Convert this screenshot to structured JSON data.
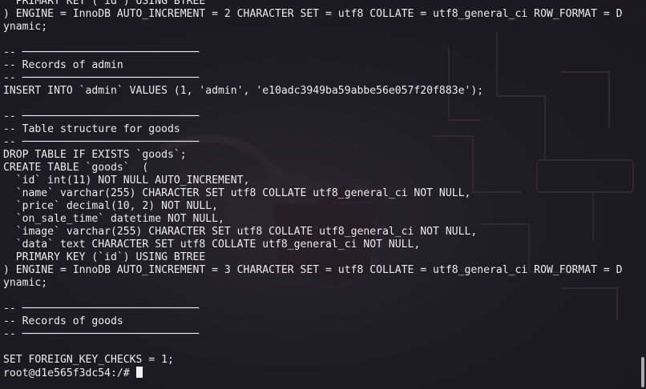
{
  "terminal": {
    "lines": [
      "  PRIMARY KEY (`id`) USING BTREE",
      ") ENGINE = InnoDB AUTO_INCREMENT = 2 CHARACTER SET = utf8 COLLATE = utf8_general_ci ROW_FORMAT = D",
      "ynamic;",
      "",
      "-- ────────────────────────────",
      "-- Records of admin",
      "-- ────────────────────────────",
      "INSERT INTO `admin` VALUES (1, 'admin', 'e10adc3949ba59abbe56e057f20f883e');",
      "",
      "-- ────────────────────────────",
      "-- Table structure for goods",
      "-- ────────────────────────────",
      "DROP TABLE IF EXISTS `goods`;",
      "CREATE TABLE `goods`  (",
      "  `id` int(11) NOT NULL AUTO_INCREMENT,",
      "  `name` varchar(255) CHARACTER SET utf8 COLLATE utf8_general_ci NOT NULL,",
      "  `price` decimal(10, 2) NOT NULL,",
      "  `on_sale_time` datetime NOT NULL,",
      "  `image` varchar(255) CHARACTER SET utf8 COLLATE utf8_general_ci NOT NULL,",
      "  `data` text CHARACTER SET utf8 COLLATE utf8_general_ci NOT NULL,",
      "  PRIMARY KEY (`id`) USING BTREE",
      ") ENGINE = InnoDB AUTO_INCREMENT = 3 CHARACTER SET = utf8 COLLATE = utf8_general_ci ROW_FORMAT = D",
      "ynamic;",
      "",
      "-- ────────────────────────────",
      "-- Records of goods",
      "-- ────────────────────────────",
      "",
      "SET FOREIGN_KEY_CHECKS = 1;"
    ],
    "prompt": "root@d1e565f3dc54:/# "
  }
}
